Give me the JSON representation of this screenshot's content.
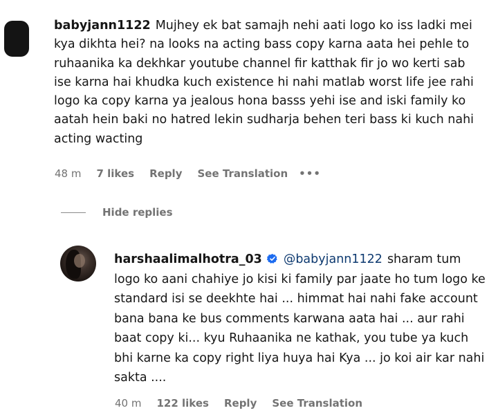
{
  "comment": {
    "username": "babyjann1122",
    "text": "Mujhey ek bat samajh nehi aati logo ko iss ladki mei kya dikhta hei? na looks na acting bass copy karna aata hei pehle to ruhaanika ka dekhkar youtube channel fir katthak fir jo wo kerti sab ise karna hai khudka kuch existence hi nahi matlab worst life jee rahi logo ka copy karna ya jealous hona basss yehi ise and iski family ko aatah hein baki no hatred lekin sudharja behen teri bass ki kuch nahi acting wacting",
    "time": "48 m",
    "likes": "7 likes",
    "reply_label": "Reply",
    "translation_label": "See Translation",
    "more": "•••",
    "avatar_icon": "avatar-icon"
  },
  "hide_replies_label": "Hide replies",
  "reply": {
    "username": "harshaalimalhotra_03",
    "verified_icon": "verified-badge-icon",
    "verified_color": "#1d6cf0",
    "mention": "@babyjann1122",
    "mention_color": "#0e3a70",
    "text": "sharam tum logo ko aani chahiye jo kisi ki family par jaate ho tum logo ke standard isi se deekhte hai ... himmat hai nahi fake account bana bana ke bus comments karwana aata hai ... aur rahi baat copy ki... kyu Ruhaanika ne kathak, you tube ya kuch bhi karne ka copy right liya huya hai Kya ... jo koi air kar nahi sakta ....",
    "time": "40 m",
    "likes": "122 likes",
    "reply_label": "Reply",
    "translation_label": "See Translation"
  },
  "colors": {
    "text": "#161616",
    "meta": "#737373",
    "background": "#ffffff"
  }
}
